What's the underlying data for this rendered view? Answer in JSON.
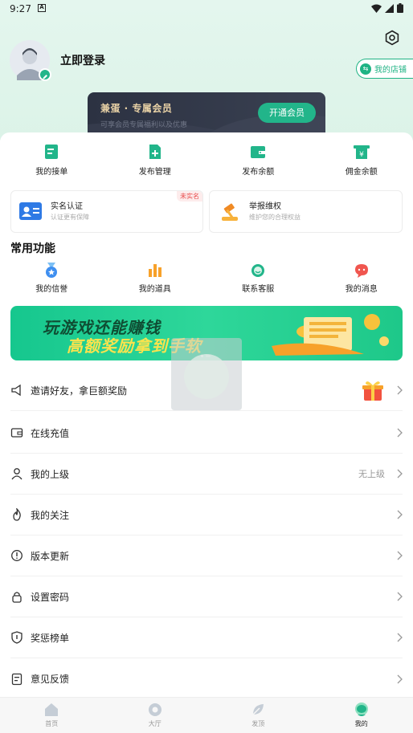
{
  "status_bar": {
    "time": "9:27",
    "notif_letter": "A"
  },
  "profile": {
    "login_text": "立即登录",
    "store_button": "我的店铺"
  },
  "vip": {
    "title": "兼蛋 · 专属会员",
    "subtitle": "可享会员专属福利以及优惠",
    "open_button": "开通会员"
  },
  "quick_actions": [
    {
      "label": "我的接单",
      "icon": "order-icon"
    },
    {
      "label": "发布管理",
      "icon": "publish-icon"
    },
    {
      "label": "发布余额",
      "icon": "wallet-icon"
    },
    {
      "label": "佣金余额",
      "icon": "commission-icon"
    }
  ],
  "cards": {
    "verify": {
      "title": "实名认证",
      "subtitle": "认证更有保障",
      "badge": "未实名"
    },
    "report": {
      "title": "举报维权",
      "subtitle": "维护您的合理权益"
    }
  },
  "common_section": {
    "title": "常用功能",
    "items": [
      {
        "label": "我的信誉",
        "icon": "medal-icon"
      },
      {
        "label": "我的道具",
        "icon": "props-icon"
      },
      {
        "label": "联系客服",
        "icon": "service-icon"
      },
      {
        "label": "我的消息",
        "icon": "message-icon"
      }
    ]
  },
  "banner": {
    "line1": "玩游戏还能赚钱",
    "line2": "高额奖励拿到手软"
  },
  "menu": {
    "invite": "邀请好友，拿巨额奖励",
    "recharge": "在线充值",
    "superior": "我的上级",
    "superior_value": "无上级",
    "follow": "我的关注",
    "update": "版本更新",
    "password": "设置密码",
    "ranking": "奖惩榜单",
    "feedback": "意见反馈"
  },
  "tabs": [
    {
      "label": "首页",
      "icon": "home-icon"
    },
    {
      "label": "大厅",
      "icon": "hall-icon"
    },
    {
      "label": "发顶",
      "icon": "boost-icon"
    },
    {
      "label": "我的",
      "icon": "profile-icon"
    }
  ],
  "colors": {
    "accent": "#22b58a",
    "badge_red": "#e84b4b",
    "vip_dark": "#2c3242",
    "vip_gold": "#e9d2a6"
  }
}
